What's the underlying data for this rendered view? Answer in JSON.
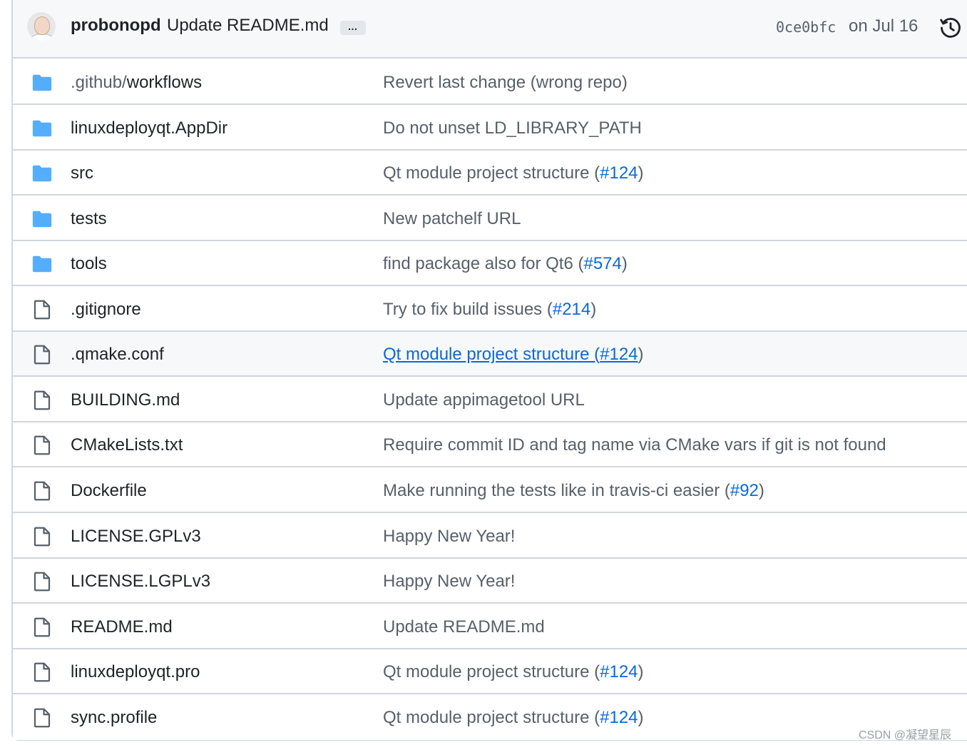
{
  "latest_commit": {
    "author": "probonopd",
    "message": "Update README.md",
    "ellipsis": "…",
    "sha": "0ce0bfc",
    "date": "on Jul 16",
    "history_icon": "history-icon",
    "avatar_icon": "avatar"
  },
  "files": [
    {
      "type": "dir",
      "icon": "folder-icon",
      "name_prefix": ".github/",
      "name": "workflows",
      "commit": "Revert last change (wrong repo)",
      "pr": "",
      "suffix": ""
    },
    {
      "type": "dir",
      "icon": "folder-icon",
      "name_prefix": "",
      "name": "linuxdeployqt.AppDir",
      "commit": "Do not unset LD_LIBRARY_PATH",
      "pr": "",
      "suffix": ""
    },
    {
      "type": "dir",
      "icon": "folder-icon",
      "name_prefix": "",
      "name": "src",
      "commit": "Qt module project structure (",
      "pr": "#124",
      "suffix": ")"
    },
    {
      "type": "dir",
      "icon": "folder-icon",
      "name_prefix": "",
      "name": "tests",
      "commit": "New patchelf URL",
      "pr": "",
      "suffix": ""
    },
    {
      "type": "dir",
      "icon": "folder-icon",
      "name_prefix": "",
      "name": "tools",
      "commit": "find package also for Qt6 (",
      "pr": "#574",
      "suffix": ")"
    },
    {
      "type": "file",
      "icon": "file-icon",
      "name_prefix": "",
      "name": ".gitignore",
      "commit": "Try to fix build issues (",
      "pr": "#214",
      "suffix": ")"
    },
    {
      "type": "file",
      "icon": "file-icon",
      "name_prefix": "",
      "name": ".qmake.conf",
      "commit": "Qt module project structure (",
      "pr": "#124",
      "suffix": ")",
      "hovered": true
    },
    {
      "type": "file",
      "icon": "file-icon",
      "name_prefix": "",
      "name": "BUILDING.md",
      "commit": "Update appimagetool URL",
      "pr": "",
      "suffix": ""
    },
    {
      "type": "file",
      "icon": "file-icon",
      "name_prefix": "",
      "name": "CMakeLists.txt",
      "commit": "Require commit ID and tag name via CMake vars if git is not found",
      "pr": "",
      "suffix": ""
    },
    {
      "type": "file",
      "icon": "file-icon",
      "name_prefix": "",
      "name": "Dockerfile",
      "commit": "Make running the tests like in travis-ci easier (",
      "pr": "#92",
      "suffix": ")"
    },
    {
      "type": "file",
      "icon": "file-icon",
      "name_prefix": "",
      "name": "LICENSE.GPLv3",
      "commit": "Happy New Year!",
      "pr": "",
      "suffix": ""
    },
    {
      "type": "file",
      "icon": "file-icon",
      "name_prefix": "",
      "name": "LICENSE.LGPLv3",
      "commit": "Happy New Year!",
      "pr": "",
      "suffix": ""
    },
    {
      "type": "file",
      "icon": "file-icon",
      "name_prefix": "",
      "name": "README.md",
      "commit": "Update README.md",
      "pr": "",
      "suffix": ""
    },
    {
      "type": "file",
      "icon": "file-icon",
      "name_prefix": "",
      "name": "linuxdeployqt.pro",
      "commit": "Qt module project structure (",
      "pr": "#124",
      "suffix": ")"
    },
    {
      "type": "file",
      "icon": "file-icon",
      "name_prefix": "",
      "name": "sync.profile",
      "commit": "Qt module project structure (",
      "pr": "#124",
      "suffix": ")"
    }
  ],
  "colors": {
    "folder": "#54aeff",
    "file": "#57606a",
    "link": "#0969da",
    "muted": "#57606a",
    "border": "#d0d7de",
    "header_bg": "#f6f8fa"
  },
  "watermark": "CSDN @凝望星辰"
}
